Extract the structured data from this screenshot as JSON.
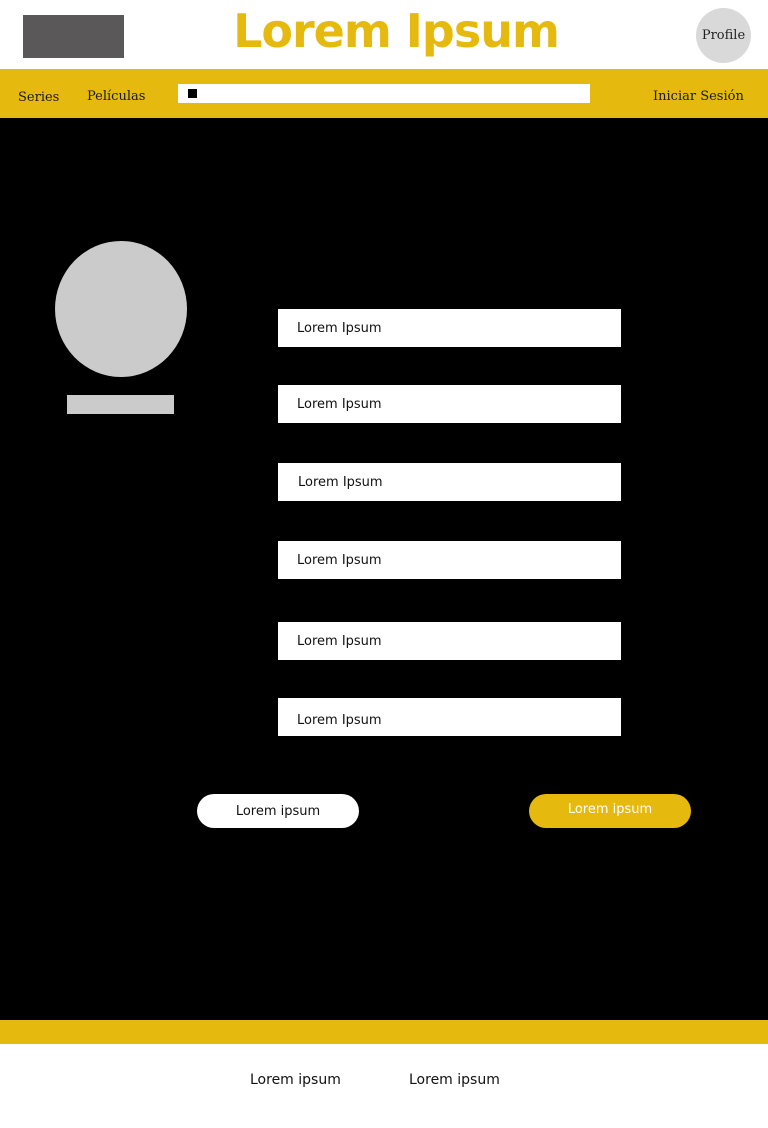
{
  "header": {
    "title": "Lorem Ipsum",
    "profile_label": "Profile"
  },
  "nav": {
    "series": "Series",
    "peliculas": "Películas",
    "login": "Iniciar Sesión",
    "search_placeholder": ""
  },
  "form": {
    "fields": [
      {
        "value": "Lorem Ipsum"
      },
      {
        "value": "Lorem Ipsum"
      },
      {
        "value": "Lorem Ipsum"
      },
      {
        "value": "Lorem Ipsum"
      },
      {
        "value": "Lorem Ipsum"
      },
      {
        "value": "Lorem Ipsum"
      }
    ],
    "secondary_button": "Lorem ipsum",
    "primary_button": "Lorem ipsum"
  },
  "footer": {
    "links": [
      "Lorem ipsum",
      "Lorem ipsum"
    ]
  },
  "colors": {
    "accent": "#e6b90e",
    "background": "#000000",
    "placeholder_gray": "#cbcbcb",
    "logo_gray": "#5a5858"
  }
}
